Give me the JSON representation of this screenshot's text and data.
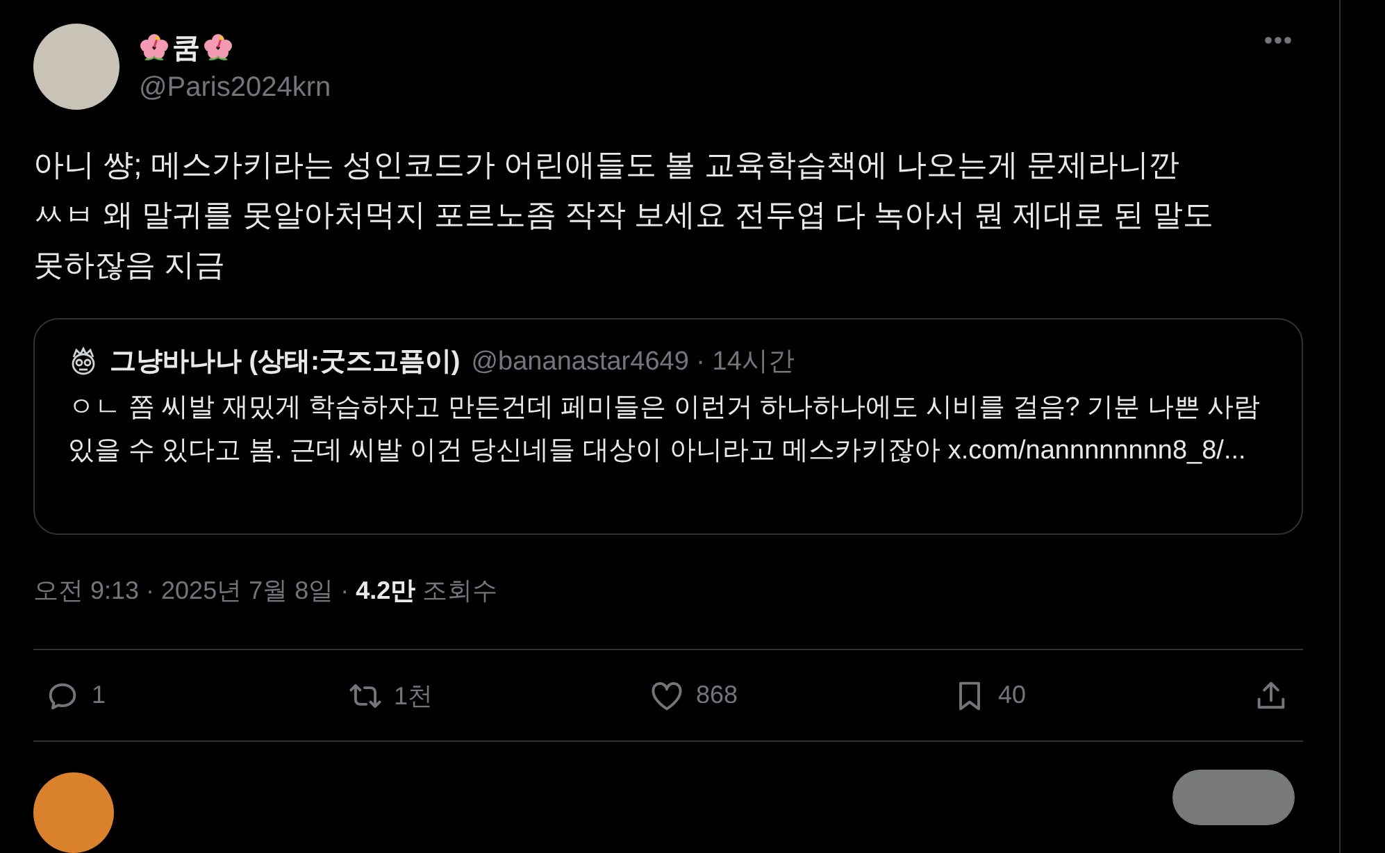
{
  "post": {
    "author": {
      "name": "쿰",
      "handle": "@Paris2024krn"
    },
    "text": "아니 썅; 메스가키라는 성인코드가 어린애들도 볼 교육학습책에 나오는게 문제라니깐 ㅆㅂ 왜 말귀를 못알아처먹지 포르노좀 작작 보세요 전두엽 다 녹아서 뭔 제대로 된 말도 못하잖음 지금",
    "quote": {
      "author": "그냥바나나 (상태:굿즈고픔이)",
      "handle_time": "@bananastar4649 · 14시간",
      "text": "ㅇㄴ 쫌 씨발 재밌게 학습하자고 만든건데 페미들은 이런거 하나하나에도 시비를 걸음? 기분 나쁜 사람 있을 수 있다고 봄. 근데 씨발 이건 당신네들 대상이 아니라고 메스카키잖아 x.com/nannnnnnnn8_8/..."
    },
    "meta": "오전 9:13 · 2025년 7월 8일 · **4.2만** 조회수",
    "actions": [
      {
        "kind": "reply",
        "count": "1"
      },
      {
        "kind": "retweet",
        "count": "1천"
      },
      {
        "kind": "like",
        "count": "868"
      },
      {
        "kind": "bookmark",
        "count": "40"
      },
      {
        "kind": "share"
      }
    ]
  }
}
